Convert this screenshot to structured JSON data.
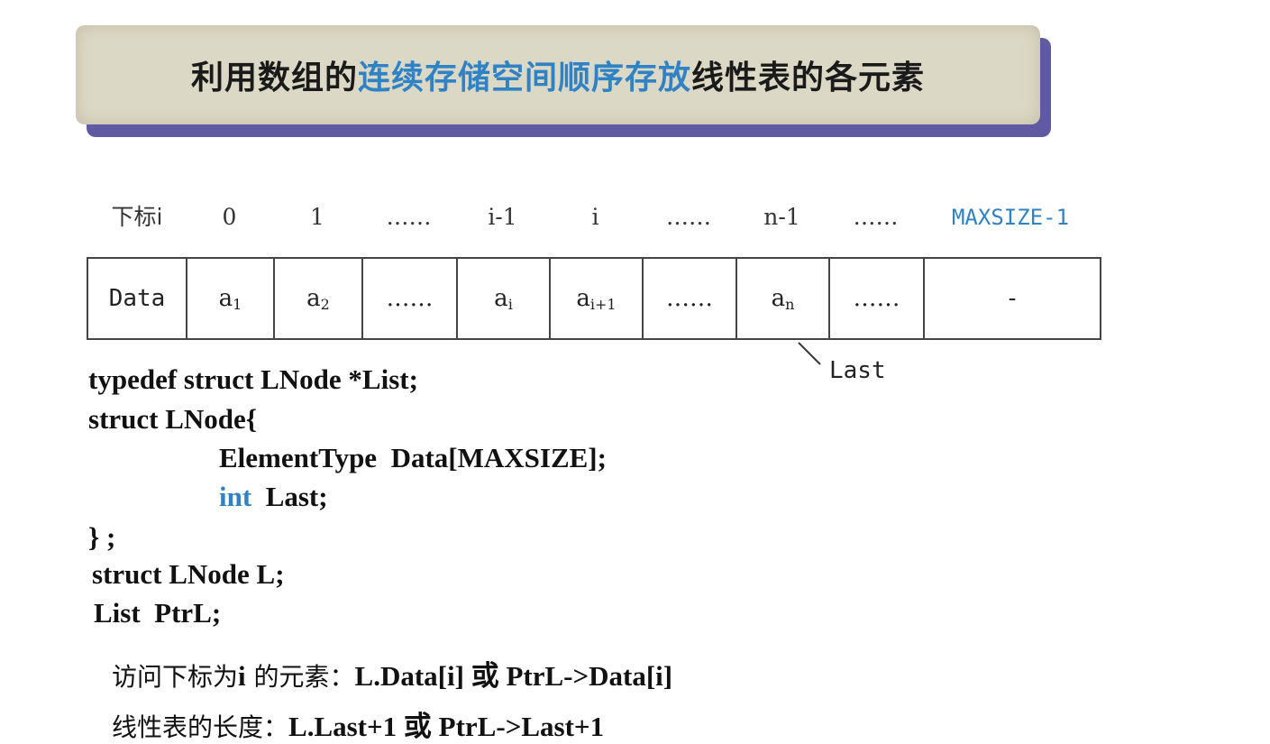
{
  "title": {
    "part1": "利用数组的",
    "highlight": "连续存储空间顺序存放",
    "part2": "线性表的各元素"
  },
  "index_row": {
    "label": "下标i",
    "indices": [
      "0",
      "1",
      "……",
      "i-1",
      "i",
      "……",
      "n-1",
      "……",
      "MAXSIZE-1"
    ]
  },
  "array": {
    "label": "Data",
    "cells": [
      {
        "base": "a",
        "sub": "1"
      },
      {
        "base": "a",
        "sub": "2"
      },
      {
        "base": "……",
        "sub": ""
      },
      {
        "base": "a",
        "sub": "i"
      },
      {
        "base": "a",
        "sub": "i+1"
      },
      {
        "base": "……",
        "sub": ""
      },
      {
        "base": "a",
        "sub": "n"
      },
      {
        "base": "……",
        "sub": ""
      },
      {
        "base": "-",
        "sub": ""
      }
    ],
    "last_pointer_label": "Last"
  },
  "code": {
    "line1": "typedef struct LNode *List;",
    "line2": "struct LNode{",
    "line3": "ElementType  Data[MAXSIZE];",
    "line4_kw": "int",
    "line4_rest": "  Last;",
    "line5": "} ;",
    "line6": "struct LNode L;",
    "line7": "List  PtrL;"
  },
  "notes": {
    "access_prefix": "访问下标为",
    "access_i": "i",
    "access_mid": " 的元素：",
    "access_expr": "L.Data[i] 或 PtrL->Data[i]",
    "length_prefix": "线性表的长度：",
    "length_expr": "L.Last+1 或 PtrL->Last+1"
  },
  "colors": {
    "highlight": "#2f82c4",
    "banner_bg": "#dcd8c6",
    "banner_shadow": "#5f5aa2"
  }
}
